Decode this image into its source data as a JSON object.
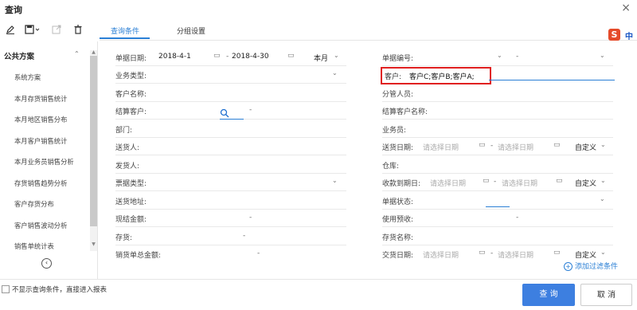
{
  "window": {
    "title": "查询",
    "close_glyph": "×"
  },
  "toolbar": {
    "icons": [
      "edit-icon",
      "save-icon",
      "export-icon",
      "delete-icon"
    ]
  },
  "sidebar": {
    "heading": "公共方案",
    "collapse_glyph": "⌃",
    "items": [
      "系统方案",
      "本月存货销售统计",
      "本月地区销售分布",
      "本月客户销售统计",
      "本月业务员销售分析",
      "存货销售趋势分析",
      "客户存货分布",
      "客户销售波动分析",
      "销售单统计表"
    ],
    "back_glyph": "‹"
  },
  "tabs": [
    {
      "label": "查询条件",
      "active": true
    },
    {
      "label": "分组设置",
      "active": false
    }
  ],
  "ime": {
    "badge": "S",
    "label": "中"
  },
  "form": {
    "left": [
      {
        "label": "单据日期:",
        "from": "2018-4-1",
        "to": "2018-4-30",
        "period": "本月"
      },
      {
        "label": "业务类型:"
      },
      {
        "label": "客户名称:"
      },
      {
        "label": "结算客户:",
        "dash": "-"
      },
      {
        "label": "部门:"
      },
      {
        "label": "送货人:"
      },
      {
        "label": "发货人:"
      },
      {
        "label": "票据类型:"
      },
      {
        "label": "送货地址:"
      },
      {
        "label": "现结金额:",
        "dash": "-"
      },
      {
        "label": "存货:",
        "dash": "-"
      },
      {
        "label": "销货单总金额:",
        "dash": "-"
      }
    ],
    "right": [
      {
        "label": "单据编号:",
        "dash": "-"
      },
      {
        "label": "客户:",
        "value": "客户C;客户B;客户A;"
      },
      {
        "label": "分管人员:"
      },
      {
        "label": "结算客户名称:"
      },
      {
        "label": "业务员:"
      },
      {
        "label": "送货日期:",
        "ph1": "请选择日期",
        "ph2": "请选择日期",
        "period": "自定义"
      },
      {
        "label": "仓库:"
      },
      {
        "label": "收款到期日:",
        "ph1": "请选择日期",
        "ph2": "请选择日期",
        "period": "自定义"
      },
      {
        "label": "单据状态:"
      },
      {
        "label": "使用预收:",
        "dash": "-"
      },
      {
        "label": "存货名称:"
      },
      {
        "label": "交货日期:",
        "ph1": "请选择日期",
        "ph2": "请选择日期",
        "period": "自定义"
      }
    ]
  },
  "add_filter": {
    "label": "添加过滤条件",
    "glyph": "+"
  },
  "footer": {
    "checkbox_label": "不显示查询条件，直接进入报表",
    "query_button": "查 询",
    "cancel_button": "取 消"
  }
}
